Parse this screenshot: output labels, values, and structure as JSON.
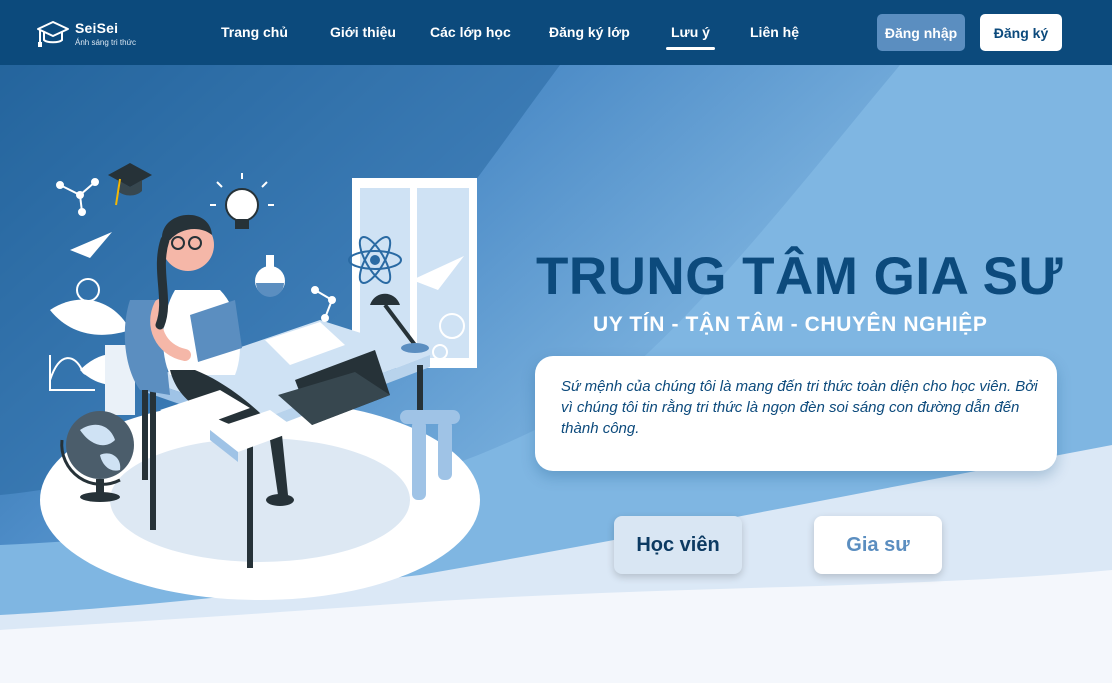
{
  "brand": {
    "name": "SeiSei",
    "tagline": "Ánh sáng tri thức",
    "icon": "graduation-cap-icon"
  },
  "nav": {
    "items": [
      {
        "label": "Trang chủ"
      },
      {
        "label": "Giới thiệu"
      },
      {
        "label": "Các lớp học"
      },
      {
        "label": "Đăng ký lớp"
      },
      {
        "label": "Lưu ý",
        "active": true
      },
      {
        "label": "Liên hệ"
      }
    ],
    "login_label": "Đăng nhập",
    "register_label": "Đăng ký"
  },
  "hero": {
    "title": "TRUNG TÂM GIA SƯ",
    "subtitle": "UY TÍN - TẬN TÂM - CHUYÊN NGHIỆP",
    "mission": "Sứ mệnh của chúng tôi là mang đến tri thức toàn diện cho học viên. Bởi vì chúng tôi tin rằng tri thức là ngọn đèn soi sáng con đường dẫn đến thành công.",
    "student_button": "Học viên",
    "tutor_button": "Gia sư"
  },
  "colors": {
    "primary": "#0c4a7c",
    "accent": "#5b8ec0",
    "light_blue": "#7fb6e2",
    "page_bg": "#eef3fa"
  }
}
